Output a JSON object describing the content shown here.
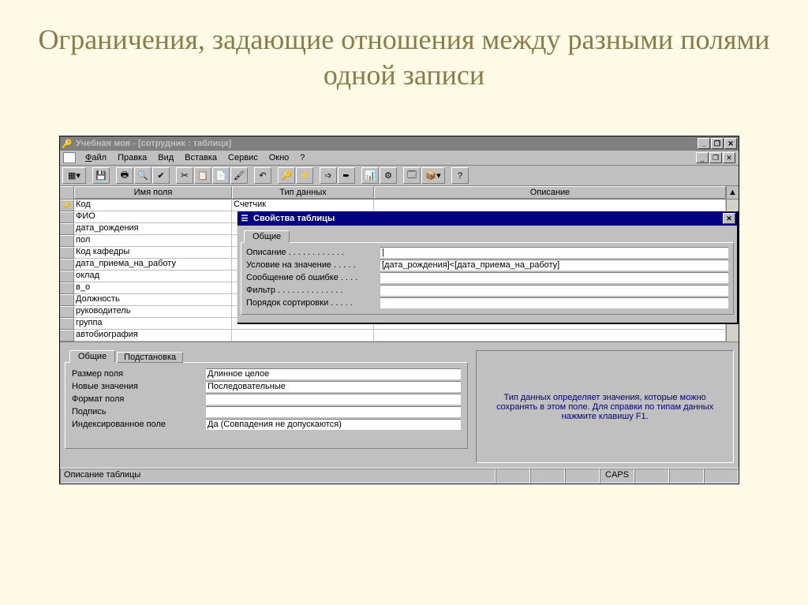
{
  "slide": {
    "title": "Ограничения, задающие отношения между разными полями одной записи"
  },
  "app": {
    "title": "Учебная моя - [сотрудник : таблица]"
  },
  "menu": {
    "file": "Файл",
    "edit": "Правка",
    "view": "Вид",
    "insert": "Вставка",
    "service": "Сервис",
    "window": "Окно",
    "help": "?"
  },
  "grid_headers": {
    "name": "Имя поля",
    "type": "Тип данных",
    "desc": "Описание"
  },
  "fields": [
    {
      "name": "Код",
      "type": "Счетчик",
      "key": true
    },
    {
      "name": "ФИО",
      "type": ""
    },
    {
      "name": "дата_рождения",
      "type": ""
    },
    {
      "name": "пол",
      "type": ""
    },
    {
      "name": "Код кафедры",
      "type": ""
    },
    {
      "name": "дата_приема_на_работу",
      "type": ""
    },
    {
      "name": "оклад",
      "type": ""
    },
    {
      "name": "в_о",
      "type": ""
    },
    {
      "name": "Должность",
      "type": ""
    },
    {
      "name": "руководитель",
      "type": ""
    },
    {
      "name": "группа",
      "type": ""
    },
    {
      "name": "автобиография",
      "type": ""
    }
  ],
  "tabs": {
    "general": "Общие",
    "lookup": "Подстановка"
  },
  "field_props": {
    "size_label": "Размер поля",
    "size_value": "Длинное целое",
    "newvals_label": "Новые значения",
    "newvals_value": "Последовательные",
    "format_label": "Формат поля",
    "format_value": "",
    "caption_label": "Подпись",
    "caption_value": "",
    "indexed_label": "Индексированное поле",
    "indexed_value": "Да (Совпадения не допускаются)"
  },
  "help_text": "Тип данных определяет значения, которые можно сохранять в этом поле.  Для справки по типам данных нажмите клавишу F1.",
  "statusbar": {
    "main": "Описание таблицы",
    "caps": "CAPS"
  },
  "dialog": {
    "title": "Свойства таблицы",
    "tab_general": "Общие",
    "rows": {
      "desc_label": "Описание . . . . . . . . . . . .",
      "desc_value": "",
      "rule_label": "Условие на значение . . . . .",
      "rule_value": "[дата_рождения]<[дата_приема_на_работу]",
      "msg_label": "Сообщение об ошибке . . . .",
      "msg_value": "",
      "filter_label": "Фильтр . . . . . . . . . . . . . .",
      "filter_value": "",
      "sort_label": "Порядок сортировки . . . . .",
      "sort_value": ""
    }
  }
}
